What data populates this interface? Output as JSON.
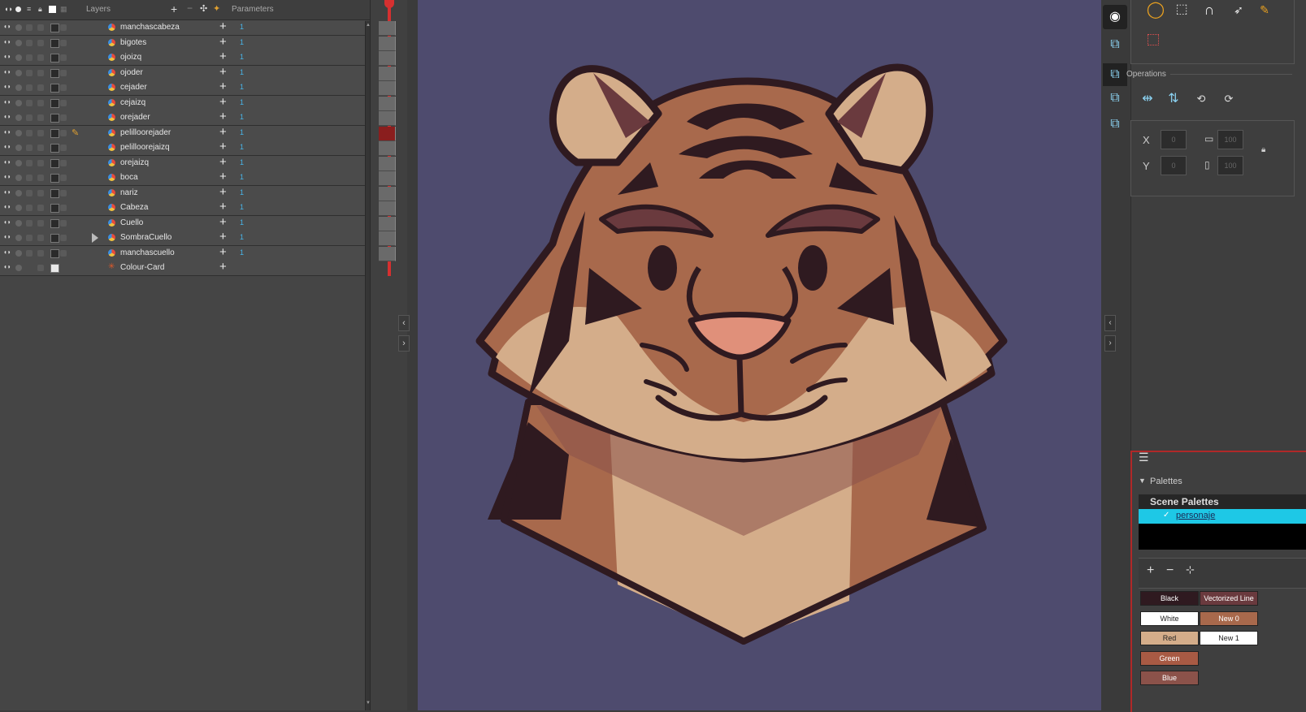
{
  "layers_panel": {
    "header_label": "Layers",
    "parameters_label": "Parameters"
  },
  "layers": [
    {
      "name": "manchascabeza",
      "value": "1"
    },
    {
      "name": "bigotes",
      "value": "1"
    },
    {
      "name": "ojoizq",
      "value": "1"
    },
    {
      "name": "ojoder",
      "value": "1"
    },
    {
      "name": "cejader",
      "value": "1"
    },
    {
      "name": "cejaizq",
      "value": "1"
    },
    {
      "name": "orejader",
      "value": "1"
    },
    {
      "name": "pelilloorejader",
      "value": "1"
    },
    {
      "name": "pelilloorejaizq",
      "value": "1"
    },
    {
      "name": "orejaizq",
      "value": "1"
    },
    {
      "name": "boca",
      "value": "1"
    },
    {
      "name": "nariz",
      "value": "1"
    },
    {
      "name": "Cabeza",
      "value": "1"
    },
    {
      "name": "Cuello",
      "value": "1"
    },
    {
      "name": "SombraCuello",
      "value": "1"
    },
    {
      "name": "manchascuello",
      "value": "1"
    },
    {
      "name": "Colour-Card",
      "value": ""
    }
  ],
  "tools_panel": {
    "operations_label": "Operations",
    "x_value": "0",
    "y_value": "0",
    "w_value": "100",
    "h_value": "100"
  },
  "palettes": {
    "title": "Palettes",
    "scene_palettes_label": "Scene Palettes",
    "selected_palette": "personaje",
    "swatches_col1": [
      {
        "label": "Black",
        "color": "#2f1a20",
        "text": "#ffffff"
      },
      {
        "label": "White",
        "color": "#ffffff",
        "text": "#222222"
      },
      {
        "label": "Red",
        "color": "#d4ad8a",
        "text": "#222222"
      },
      {
        "label": "Green",
        "color": "#a85a44",
        "text": "#ffffff"
      },
      {
        "label": "Blue",
        "color": "#8b524a",
        "text": "#ffffff"
      }
    ],
    "swatches_col2": [
      {
        "label": "Vectorized Line",
        "color": "#6a3a3e",
        "text": "#ffffff"
      },
      {
        "label": "New 0",
        "color": "#a8694c",
        "text": "#ffffff"
      },
      {
        "label": "New 1",
        "color": "#ffffff",
        "text": "#222222"
      }
    ]
  },
  "colors": {
    "canvas_bg": "#4e4b6e",
    "accent_cyan": "#1ec8e6",
    "accent_red": "#b02828"
  }
}
